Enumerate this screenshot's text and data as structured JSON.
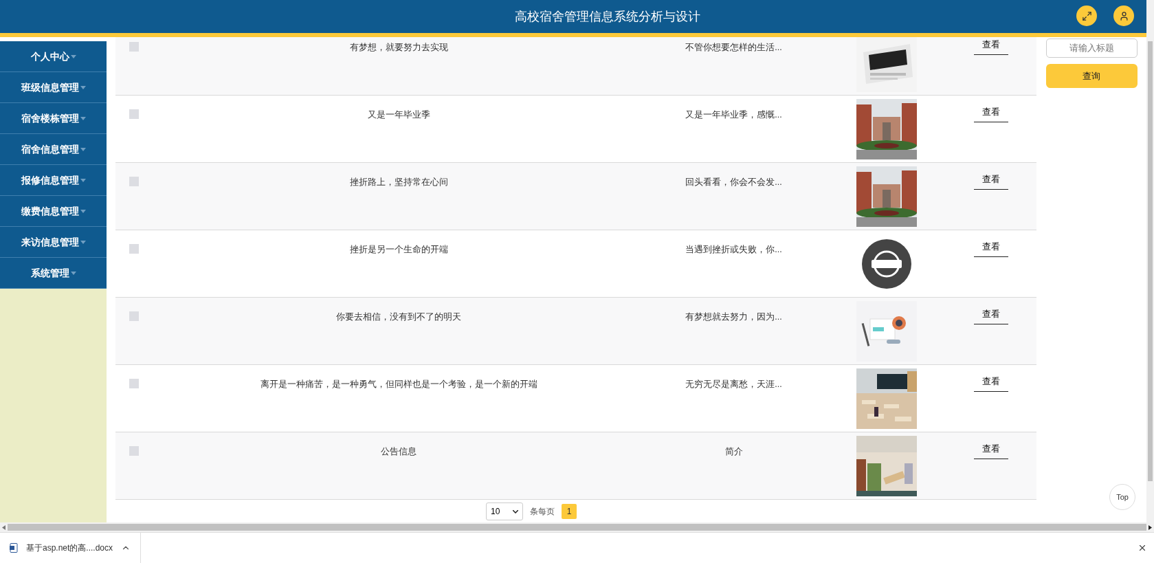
{
  "header": {
    "title": "高校宿舍管理信息系统分析与设计"
  },
  "sidebar": {
    "items": [
      {
        "label": "个人中心"
      },
      {
        "label": "班级信息管理"
      },
      {
        "label": "宿舍楼栋管理"
      },
      {
        "label": "宿舍信息管理"
      },
      {
        "label": "报修信息管理"
      },
      {
        "label": "缴费信息管理"
      },
      {
        "label": "来访信息管理"
      },
      {
        "label": "系统管理"
      }
    ]
  },
  "table": {
    "rows": [
      {
        "checked": false,
        "title": "有梦想，就要努力去实现",
        "summary": "不管你想要怎样的生活...",
        "action": "查看"
      },
      {
        "checked": false,
        "title": "又是一年毕业季",
        "summary": "又是一年毕业季，感慨...",
        "action": "查看"
      },
      {
        "checked": false,
        "title": "挫折路上，坚持常在心间",
        "summary": "回头看看，你会不会发...",
        "action": "查看"
      },
      {
        "checked": false,
        "title": "挫折是另一个生命的开端",
        "summary": "当遇到挫折或失败，你...",
        "action": "查看"
      },
      {
        "checked": false,
        "title": "你要去相信，没有到不了的明天",
        "summary": "有梦想就去努力，因为...",
        "action": "查看"
      },
      {
        "checked": false,
        "title": "离开是一种痛苦，是一种勇气，但同样也是一个考验，是一个新的开端",
        "summary": "无穷无尽是离愁，天涯...",
        "action": "查看"
      },
      {
        "checked": false,
        "title": "公告信息",
        "summary": "简介",
        "action": "查看"
      }
    ]
  },
  "pagination": {
    "page_size": "10",
    "page_size_label": "条每页",
    "pages": [
      {
        "label": "1",
        "selected": true
      }
    ]
  },
  "search": {
    "placeholder": "请输入标题",
    "button": "查询"
  },
  "back_to_top": "Top",
  "download_bar": {
    "file": "基于asp.net的高....docx"
  }
}
